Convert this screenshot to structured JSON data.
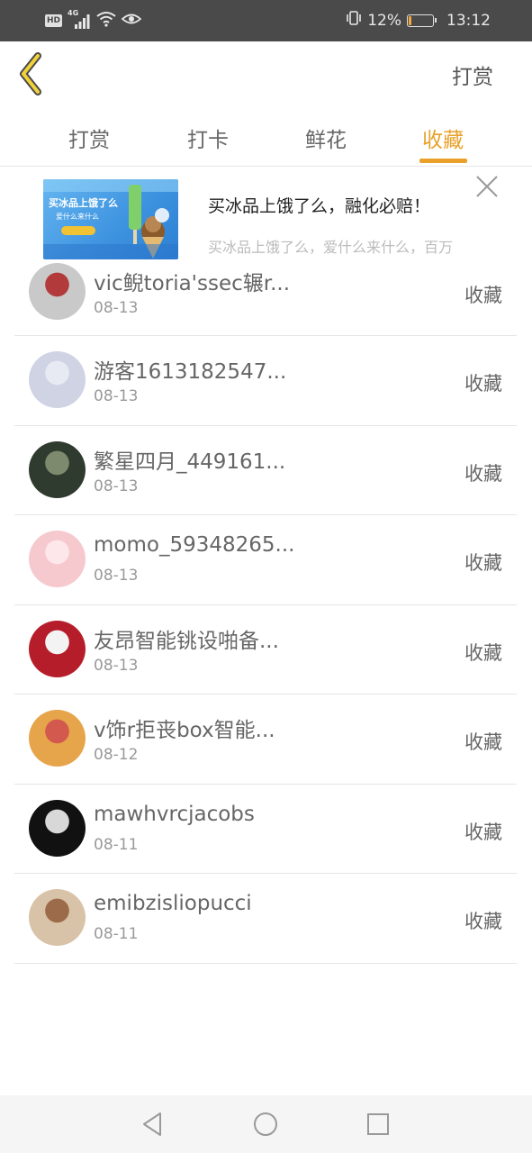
{
  "status_bar": {
    "hd_label": "HD",
    "network_label": "4G",
    "battery_percent": "12%",
    "battery_level": 0.12,
    "time": "13:12"
  },
  "header": {
    "back_icon": "chevron-left-icon",
    "action_label": "打赏",
    "accent_color": "#e9a12a"
  },
  "tabs": [
    {
      "label": "打赏",
      "active": false
    },
    {
      "label": "打卡",
      "active": false
    },
    {
      "label": "鲜花",
      "active": false
    },
    {
      "label": "收藏",
      "active": true
    }
  ],
  "ad": {
    "title": "买冰品上饿了么，融化必赔！",
    "description": "买冰品上饿了么，爱什么来什么，百万",
    "image_text": "买冰品上饿了么",
    "image_subtext": "爱什么来什么"
  },
  "list": [
    {
      "name": "vic鲵toria'ssec辗r...",
      "date": "08-13",
      "action": "收藏",
      "avatar_colors": [
        "#c9c9c9",
        "#b23a3a"
      ]
    },
    {
      "name": "游客1613182547...",
      "date": "08-13",
      "action": "收藏",
      "avatar_colors": [
        "#cfd3e4",
        "#e8eaf3"
      ]
    },
    {
      "name": "繁星四月_449161...",
      "date": "08-13",
      "action": "收藏",
      "avatar_colors": [
        "#2f3b2f",
        "#7d8a6e"
      ]
    },
    {
      "name": "momo_59348265...",
      "date": "08-13",
      "action": "收藏",
      "avatar_colors": [
        "#f6c9cf",
        "#fde7ea"
      ]
    },
    {
      "name": "友昂智能铫设啪备...",
      "date": "08-13",
      "action": "收藏",
      "avatar_colors": [
        "#b61d2a",
        "#f3f3f3"
      ]
    },
    {
      "name": "v饰r拒丧box智能...",
      "date": "08-12",
      "action": "收藏",
      "avatar_colors": [
        "#e6a54a",
        "#d3584e"
      ]
    },
    {
      "name": "mawhvrcjacobs",
      "date": "08-11",
      "action": "收藏",
      "avatar_colors": [
        "#111111",
        "#d8d8d8"
      ]
    },
    {
      "name": "emibzisliopucci",
      "date": "08-11",
      "action": "收藏",
      "avatar_colors": [
        "#d9c3a8",
        "#9b6b4a"
      ]
    }
  ],
  "nav_bar": {
    "back_icon": "triangle-back-icon",
    "home_icon": "circle-home-icon",
    "recents_icon": "square-recents-icon"
  }
}
